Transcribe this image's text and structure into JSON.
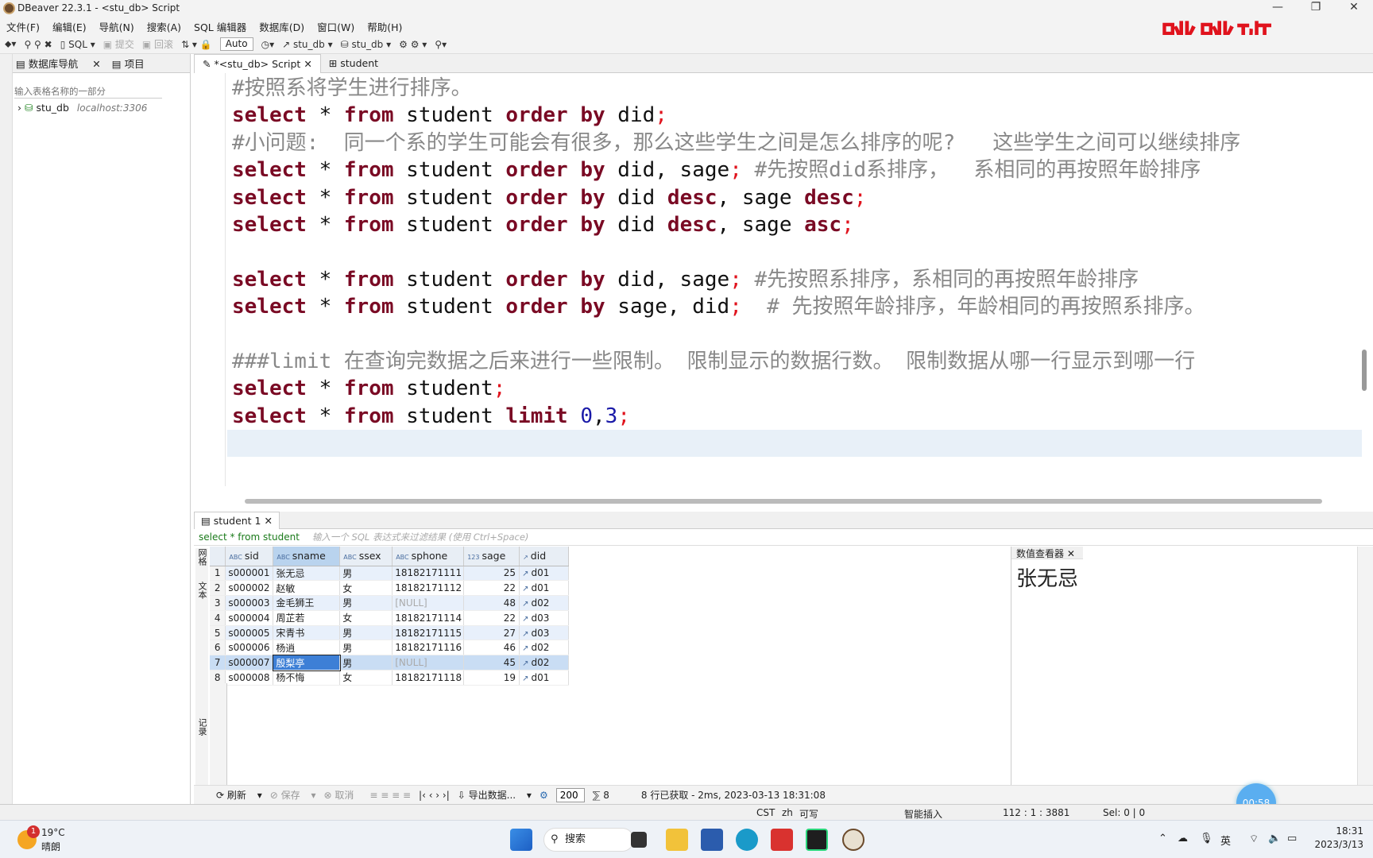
{
  "window": {
    "title": "DBeaver 22.3.1 - <stu_db> Script",
    "controls": [
      "—",
      "❐",
      "✕"
    ]
  },
  "watermark": "跳跳班",
  "menu": [
    "文件(F)",
    "编辑(E)",
    "导航(N)",
    "搜索(A)",
    "SQL 编辑器",
    "数据库(D)",
    "窗口(W)",
    "帮助(H)"
  ],
  "toolbar": {
    "sql": "SQL",
    "commit": "提交",
    "rollback": "回滚",
    "mode": "Auto",
    "datasource": "stu_db",
    "schema": "stu_db"
  },
  "left_panel": {
    "tabs": [
      "数据库导航",
      "项目"
    ],
    "filter_placeholder": "输入表格名称的一部分",
    "tree": {
      "name": "stu_db",
      "host": "localhost:3306"
    }
  },
  "editor_tabs": [
    "*<stu_db> Script",
    "student"
  ],
  "editor": {
    "lines": [
      [
        [
          "cm",
          "#按照系将学生进行排序。"
        ]
      ],
      [
        [
          "kw",
          "select"
        ],
        [
          "t",
          " * "
        ],
        [
          "kw",
          "from"
        ],
        [
          "t",
          " student "
        ],
        [
          "kw",
          "order by"
        ],
        [
          "t",
          " did"
        ],
        [
          "sm",
          ";"
        ]
      ],
      [
        [
          "cm",
          "#小问题:  同一个系的学生可能会有很多，那么这些学生之间是怎么排序的呢?   这些学生之间可以继续排序"
        ]
      ],
      [
        [
          "kw",
          "select"
        ],
        [
          "t",
          " * "
        ],
        [
          "kw",
          "from"
        ],
        [
          "t",
          " student "
        ],
        [
          "kw",
          "order by"
        ],
        [
          "t",
          " did, sage"
        ],
        [
          "sm",
          ";"
        ],
        [
          "cm",
          " #先按照did系排序，  系相同的再按照年龄排序"
        ]
      ],
      [
        [
          "kw",
          "select"
        ],
        [
          "t",
          " * "
        ],
        [
          "kw",
          "from"
        ],
        [
          "t",
          " student "
        ],
        [
          "kw",
          "order by"
        ],
        [
          "t",
          " did "
        ],
        [
          "kw",
          "desc"
        ],
        [
          "t",
          ", sage "
        ],
        [
          "kw",
          "desc"
        ],
        [
          "sm",
          ";"
        ]
      ],
      [
        [
          "kw",
          "select"
        ],
        [
          "t",
          " * "
        ],
        [
          "kw",
          "from"
        ],
        [
          "t",
          " student "
        ],
        [
          "kw",
          "order by"
        ],
        [
          "t",
          " did "
        ],
        [
          "kw",
          "desc"
        ],
        [
          "t",
          ", sage "
        ],
        [
          "kw",
          "asc"
        ],
        [
          "sm",
          ";"
        ]
      ],
      [],
      [
        [
          "kw",
          "select"
        ],
        [
          "t",
          " * "
        ],
        [
          "kw",
          "from"
        ],
        [
          "t",
          " student "
        ],
        [
          "kw",
          "order by"
        ],
        [
          "t",
          " did, sage"
        ],
        [
          "sm",
          ";"
        ],
        [
          "cm",
          " #先按照系排序，系相同的再按照年龄排序"
        ]
      ],
      [
        [
          "kw",
          "select"
        ],
        [
          "t",
          " * "
        ],
        [
          "kw",
          "from"
        ],
        [
          "t",
          " student "
        ],
        [
          "kw",
          "order by"
        ],
        [
          "t",
          " sage, did"
        ],
        [
          "sm",
          ";"
        ],
        [
          "cm",
          "  # 先按照年龄排序，年龄相同的再按照系排序。"
        ]
      ],
      [],
      [
        [
          "cm",
          "###limit 在查询完数据之后来进行一些限制。 限制显示的数据行数。 限制数据从哪一行显示到哪一行"
        ]
      ],
      [
        [
          "kw",
          "select"
        ],
        [
          "t",
          " * "
        ],
        [
          "kw",
          "from"
        ],
        [
          "t",
          " student"
        ],
        [
          "sm",
          ";"
        ]
      ],
      [
        [
          "kw",
          "select"
        ],
        [
          "t",
          " * "
        ],
        [
          "kw",
          "from"
        ],
        [
          "t",
          " student "
        ],
        [
          "kw",
          "limit"
        ],
        [
          "t",
          " "
        ],
        [
          "nu",
          "0"
        ],
        [
          "t",
          ","
        ],
        [
          "nu",
          "3"
        ],
        [
          "sm",
          ";"
        ]
      ],
      []
    ]
  },
  "results": {
    "tab": "student 1",
    "query": "select * from student",
    "filter_placeholder": "输入一个 SQL 表达式来过滤结果 (使用 Ctrl+Space)",
    "side_tabs": [
      "网格",
      "文本",
      "记录"
    ],
    "columns": [
      {
        "type": "ABC",
        "name": "sid"
      },
      {
        "type": "ABC",
        "name": "sname"
      },
      {
        "type": "ABC",
        "name": "ssex"
      },
      {
        "type": "ABC",
        "name": "sphone"
      },
      {
        "type": "123",
        "name": "sage"
      },
      {
        "type": "↗",
        "name": "did"
      }
    ],
    "rows": [
      [
        "1",
        "s000001",
        "张无忌",
        "男",
        "18182171111",
        "25",
        "d01"
      ],
      [
        "2",
        "s000002",
        "赵敏",
        "女",
        "18182171112",
        "22",
        "d01"
      ],
      [
        "3",
        "s000003",
        "金毛狮王",
        "男",
        "[NULL]",
        "48",
        "d02"
      ],
      [
        "4",
        "s000004",
        "周芷若",
        "女",
        "18182171114",
        "22",
        "d03"
      ],
      [
        "5",
        "s000005",
        "宋青书",
        "男",
        "18182171115",
        "27",
        "d03"
      ],
      [
        "6",
        "s000006",
        "杨逍",
        "男",
        "18182171116",
        "46",
        "d02"
      ],
      [
        "7",
        "s000007",
        "殷梨亭",
        "男",
        "[NULL]",
        "45",
        "d02"
      ],
      [
        "8",
        "s000008",
        "杨不悔",
        "女",
        "18182171118",
        "19",
        "d01"
      ]
    ],
    "value_viewer": {
      "title": "数值查看器",
      "value": "张无忌"
    },
    "bottom": {
      "refresh": "刷新",
      "save": "保存",
      "cancel": "取消",
      "export": "导出数据...",
      "limit": "200",
      "count": "8",
      "status": "8 行已获取 - 2ms, 2023-03-13 18:31:08"
    }
  },
  "statusbar": {
    "tz": "CST",
    "lang": "zh",
    "mode": "可写",
    "insert": "智能插入",
    "pos": "112 : 1 : 3881",
    "sel": "Sel: 0 | 0"
  },
  "timer": "00:58",
  "taskbar": {
    "temp": "19°C",
    "condition": "晴朗",
    "notif": "1",
    "search": "搜索",
    "tray": {
      "ime": "英",
      "time": "18:31",
      "date": "2023/3/13"
    }
  }
}
